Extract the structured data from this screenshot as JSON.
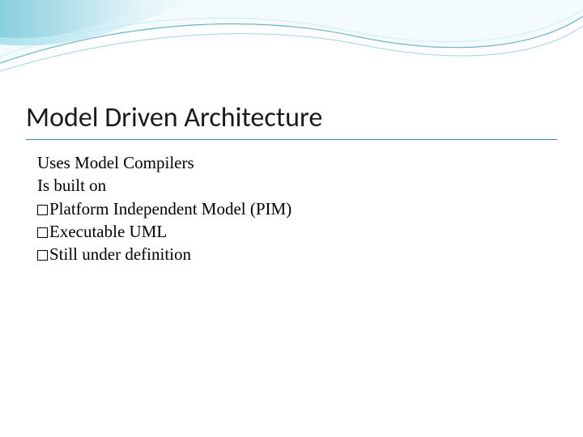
{
  "slide": {
    "title": "Model Driven Architecture",
    "lines": {
      "l1": "Uses Model Compilers",
      "l2": "Is built on",
      "b1": "Platform Independent Model (PIM)",
      "b2": "Executable UML",
      "b3": "Still under definition"
    }
  },
  "theme": {
    "accent": "#2f8a9e",
    "wave_light": "#a8e0ec",
    "wave_mid": "#6fc4d6"
  }
}
